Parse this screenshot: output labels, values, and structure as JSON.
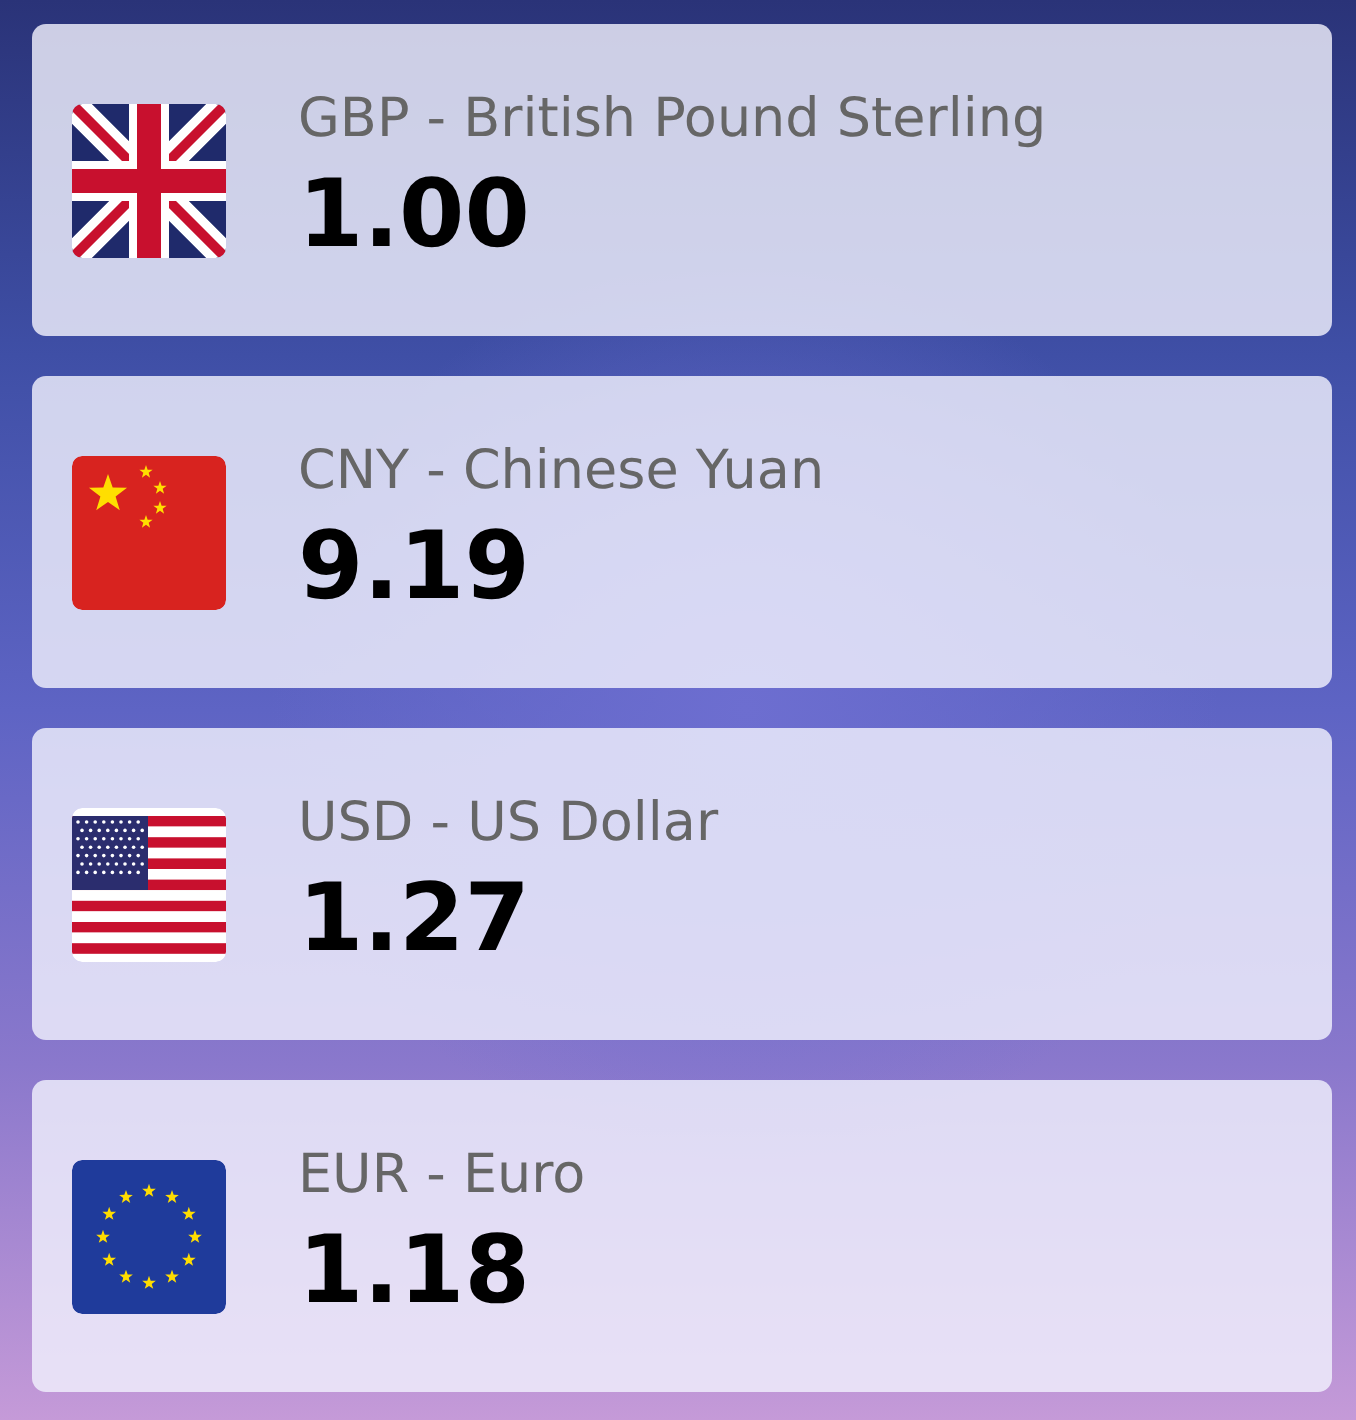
{
  "currencies": [
    {
      "kind": "gb",
      "label": "GBP - British Pound Sterling",
      "rate": "1.00"
    },
    {
      "kind": "cn",
      "label": "CNY - Chinese Yuan",
      "rate": "9.19"
    },
    {
      "kind": "us",
      "label": "USD - US Dollar",
      "rate": "1.27"
    },
    {
      "kind": "eu",
      "label": "EUR - Euro",
      "rate": "1.18"
    }
  ]
}
